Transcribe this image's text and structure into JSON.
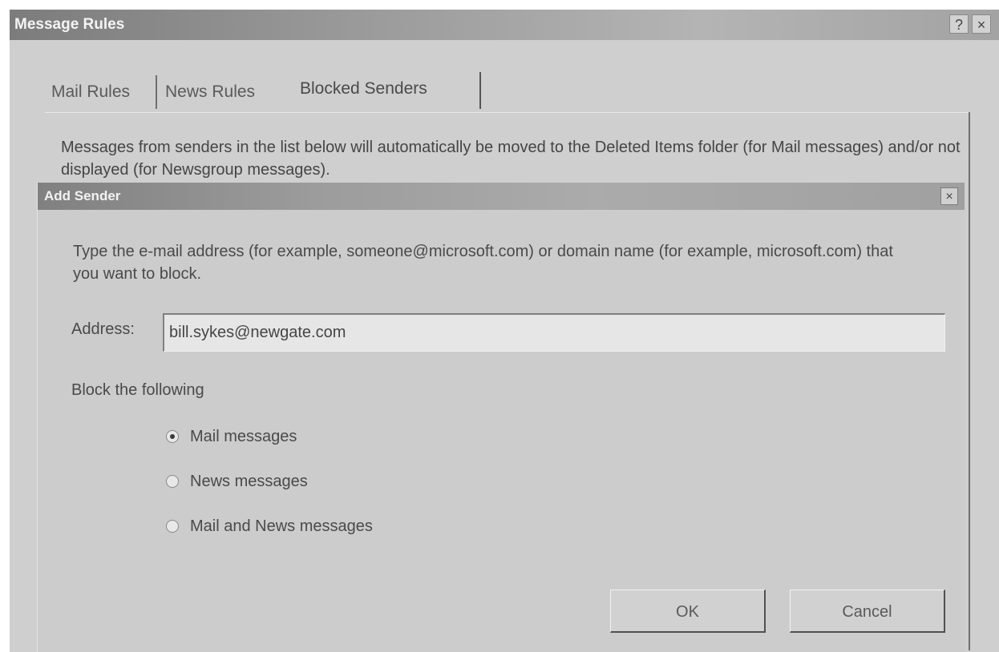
{
  "outer_window": {
    "title": "Message Rules",
    "help_button": "?",
    "close_button": "×"
  },
  "tabs": [
    {
      "label": "Mail Rules"
    },
    {
      "label": "News Rules"
    },
    {
      "label": "Blocked Senders"
    }
  ],
  "panel": {
    "description": "Messages from senders in the list below will automatically be moved to the Deleted Items folder (for Mail messages) and/or not displayed (for Newsgroup messages)."
  },
  "dialog": {
    "title": "Add Sender",
    "close_button": "×",
    "instructions": "Type the e-mail address (for example, someone@microsoft.com) or domain name (for example, microsoft.com) that you want to block.",
    "address_label": "Address:",
    "address_value": "bill.sykes@newgate.com",
    "block_label": "Block the following",
    "options": [
      {
        "label": "Mail messages",
        "checked": true
      },
      {
        "label": "News messages",
        "checked": false
      },
      {
        "label": "Mail and News messages",
        "checked": false
      }
    ],
    "ok_label": "OK",
    "cancel_label": "Cancel"
  }
}
